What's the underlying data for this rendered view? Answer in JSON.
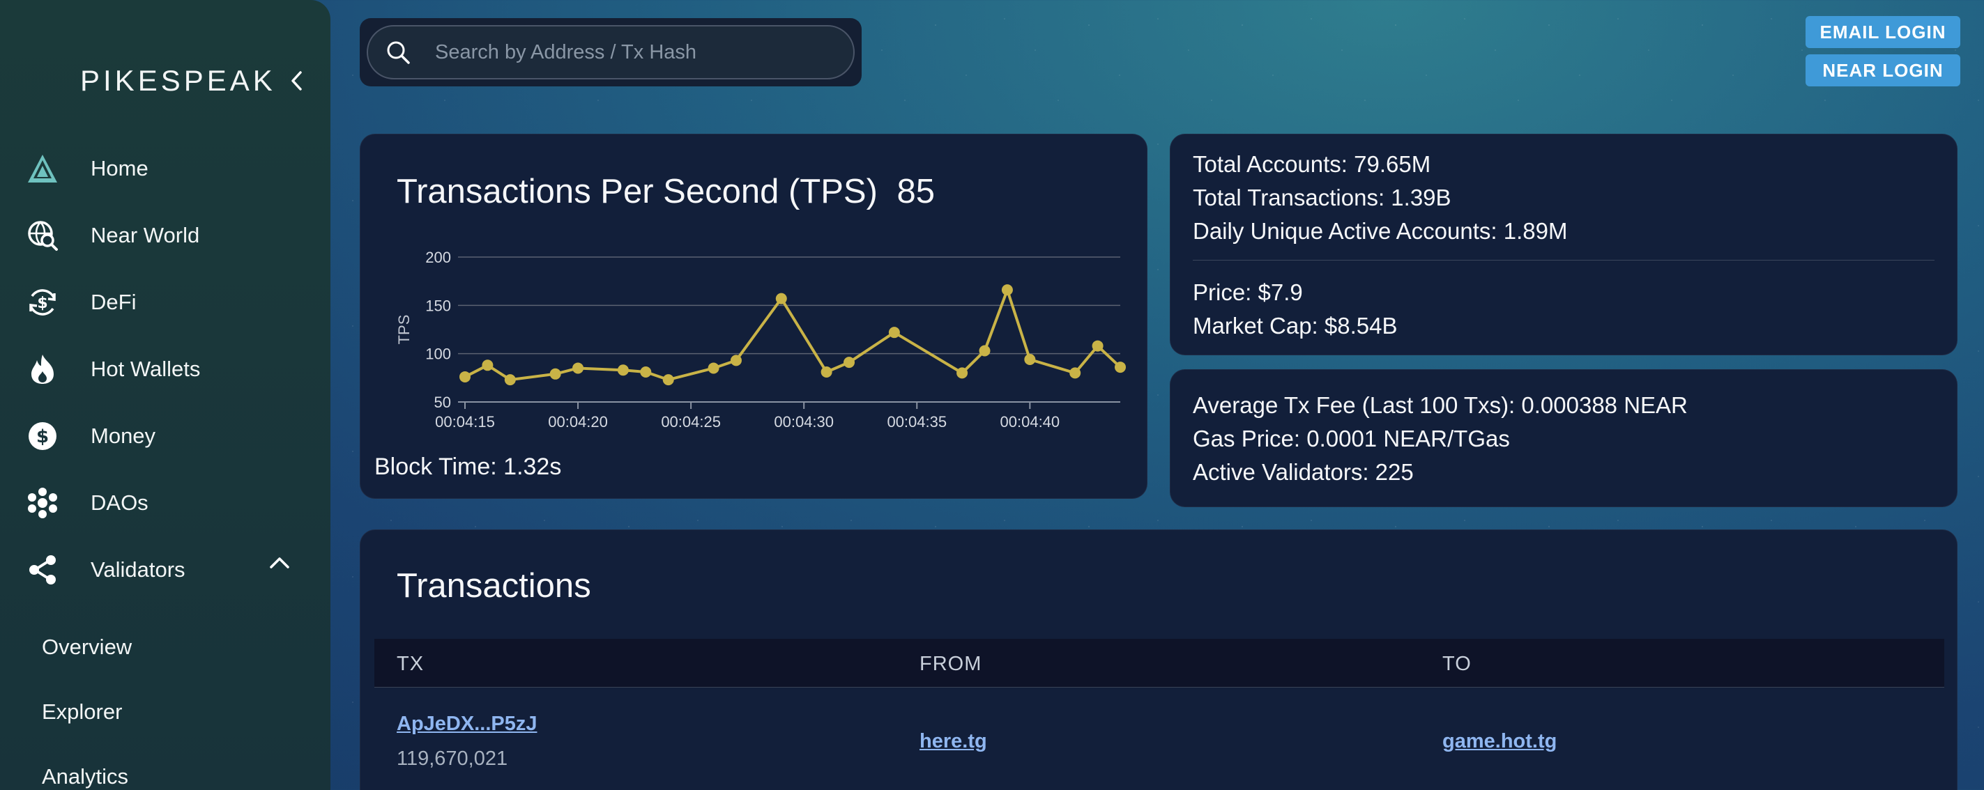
{
  "sidebar": {
    "brand": "PIKESPEAK",
    "items": [
      {
        "label": "Home",
        "icon": "mountain-icon"
      },
      {
        "label": "Near World",
        "icon": "globe-search-icon"
      },
      {
        "label": "DeFi",
        "icon": "dollar-cycle-icon"
      },
      {
        "label": "Hot Wallets",
        "icon": "fire-icon"
      },
      {
        "label": "Money",
        "icon": "dollar-coin-icon"
      },
      {
        "label": "DAOs",
        "icon": "dao-cluster-icon"
      },
      {
        "label": "Validators",
        "icon": "share-nodes-icon",
        "expanded": true
      }
    ],
    "validators_subitems": [
      "Overview",
      "Explorer",
      "Analytics"
    ]
  },
  "search": {
    "placeholder": "Search by Address / Tx Hash"
  },
  "header": {
    "email_login": "EMAIL LOGIN",
    "near_login": "NEAR LOGIN"
  },
  "tps": {
    "title": "Transactions Per Second (TPS)",
    "value": "85",
    "block_time": "Block Time: 1.32s"
  },
  "stats": {
    "total_accounts": "Total Accounts: 79.65M",
    "total_transactions": "Total Transactions: 1.39B",
    "daily_active": "Daily Unique Active Accounts: 1.89M",
    "price": "Price: $7.9",
    "market_cap": "Market Cap: $8.54B"
  },
  "fees": {
    "avg_fee": "Average Tx Fee (Last 100 Txs): 0.000388 NEAR",
    "gas_price": "Gas Price: 0.0001 NEAR/TGas",
    "validators": "Active Validators: 225"
  },
  "transactions": {
    "title": "Transactions",
    "columns": [
      "TX",
      "FROM",
      "TO"
    ],
    "rows": [
      {
        "tx": "ApJeDX...P5zJ",
        "block": "119,670,021",
        "from": "here.tg",
        "to": "game.hot.tg"
      }
    ]
  },
  "colors": {
    "accent": "#3f9ad8",
    "line": "#c9b347",
    "card": "#121f3a",
    "sidebar": "#1b3a3a"
  },
  "chart_data": {
    "type": "line",
    "title": "Transactions Per Second (TPS) 85",
    "xlabel": "",
    "ylabel": "TPS",
    "ylim": [
      50,
      200
    ],
    "yticks": [
      50,
      100,
      150,
      200
    ],
    "xticks": [
      "00:04:15",
      "00:04:20",
      "00:04:25",
      "00:04:30",
      "00:04:35",
      "00:04:40"
    ],
    "grid": true,
    "series": [
      {
        "points": [
          {
            "x": "00:04:15",
            "y": 76
          },
          {
            "x": "00:04:16",
            "y": 88
          },
          {
            "x": "00:04:17",
            "y": 73
          },
          {
            "x": "00:04:19",
            "y": 79
          },
          {
            "x": "00:04:20",
            "y": 85
          },
          {
            "x": "00:04:22",
            "y": 83
          },
          {
            "x": "00:04:23",
            "y": 81
          },
          {
            "x": "00:04:24",
            "y": 73
          },
          {
            "x": "00:04:26",
            "y": 85
          },
          {
            "x": "00:04:27",
            "y": 93
          },
          {
            "x": "00:04:29",
            "y": 157
          },
          {
            "x": "00:04:31",
            "y": 81
          },
          {
            "x": "00:04:32",
            "y": 91
          },
          {
            "x": "00:04:34",
            "y": 122
          },
          {
            "x": "00:04:37",
            "y": 80
          },
          {
            "x": "00:04:38",
            "y": 103
          },
          {
            "x": "00:04:39",
            "y": 166
          },
          {
            "x": "00:04:40",
            "y": 94
          },
          {
            "x": "00:04:42",
            "y": 80
          },
          {
            "x": "00:04:43",
            "y": 108
          },
          {
            "x": "00:04:44",
            "y": 86
          }
        ]
      }
    ]
  }
}
